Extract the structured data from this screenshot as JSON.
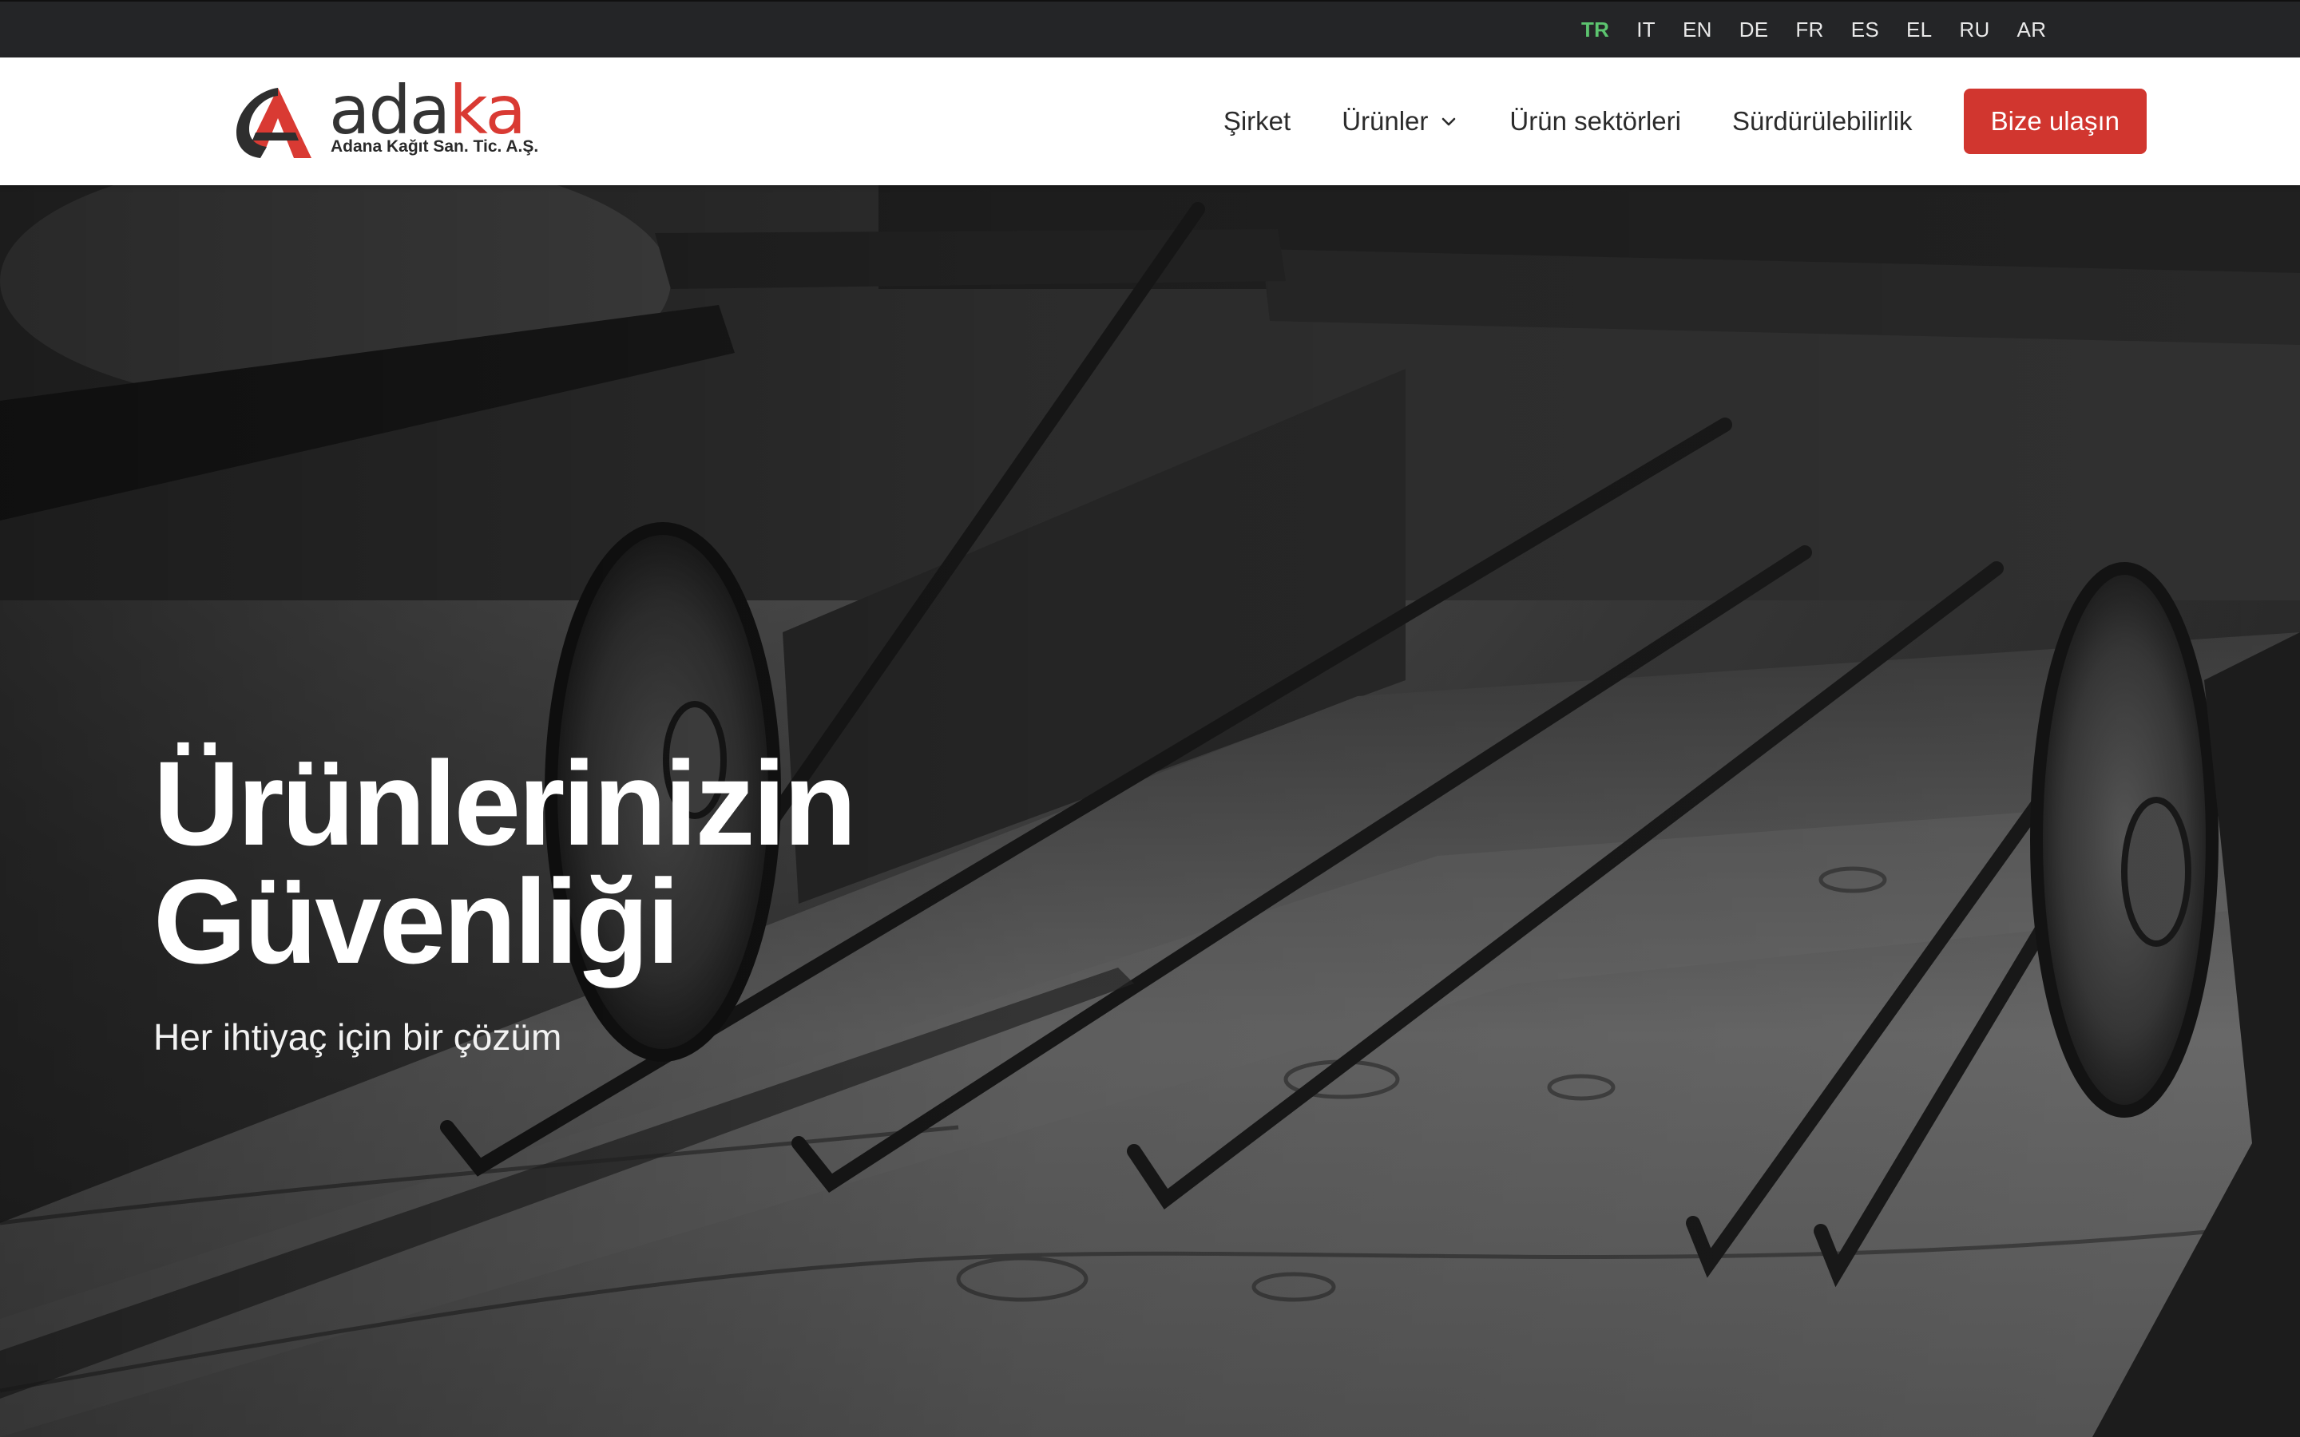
{
  "languages": [
    {
      "code": "TR",
      "active": true
    },
    {
      "code": "IT",
      "active": false
    },
    {
      "code": "EN",
      "active": false
    },
    {
      "code": "DE",
      "active": false
    },
    {
      "code": "FR",
      "active": false
    },
    {
      "code": "ES",
      "active": false
    },
    {
      "code": "EL",
      "active": false
    },
    {
      "code": "RU",
      "active": false
    },
    {
      "code": "AR",
      "active": false
    }
  ],
  "logo": {
    "word_part1": "ada",
    "word_part2": "ka",
    "tagline": "Adana Kağıt San. Tic. A.Ş."
  },
  "nav": {
    "items": [
      {
        "label": "Şirket",
        "has_dropdown": false
      },
      {
        "label": "Ürünler",
        "has_dropdown": true
      },
      {
        "label": "Ürün sektörleri",
        "has_dropdown": false
      },
      {
        "label": "Sürdürülebilirlik",
        "has_dropdown": false
      }
    ],
    "cta_label": "Bize ulaşın"
  },
  "hero": {
    "title_line1": "Ürünlerinizin",
    "title_line2": "Güvenliği",
    "subtitle": "Her ihtiyaç için bir çözüm"
  },
  "colors": {
    "brand_red": "#d1362f",
    "active_lang": "#5cc46f",
    "topbar_bg": "#242527"
  }
}
